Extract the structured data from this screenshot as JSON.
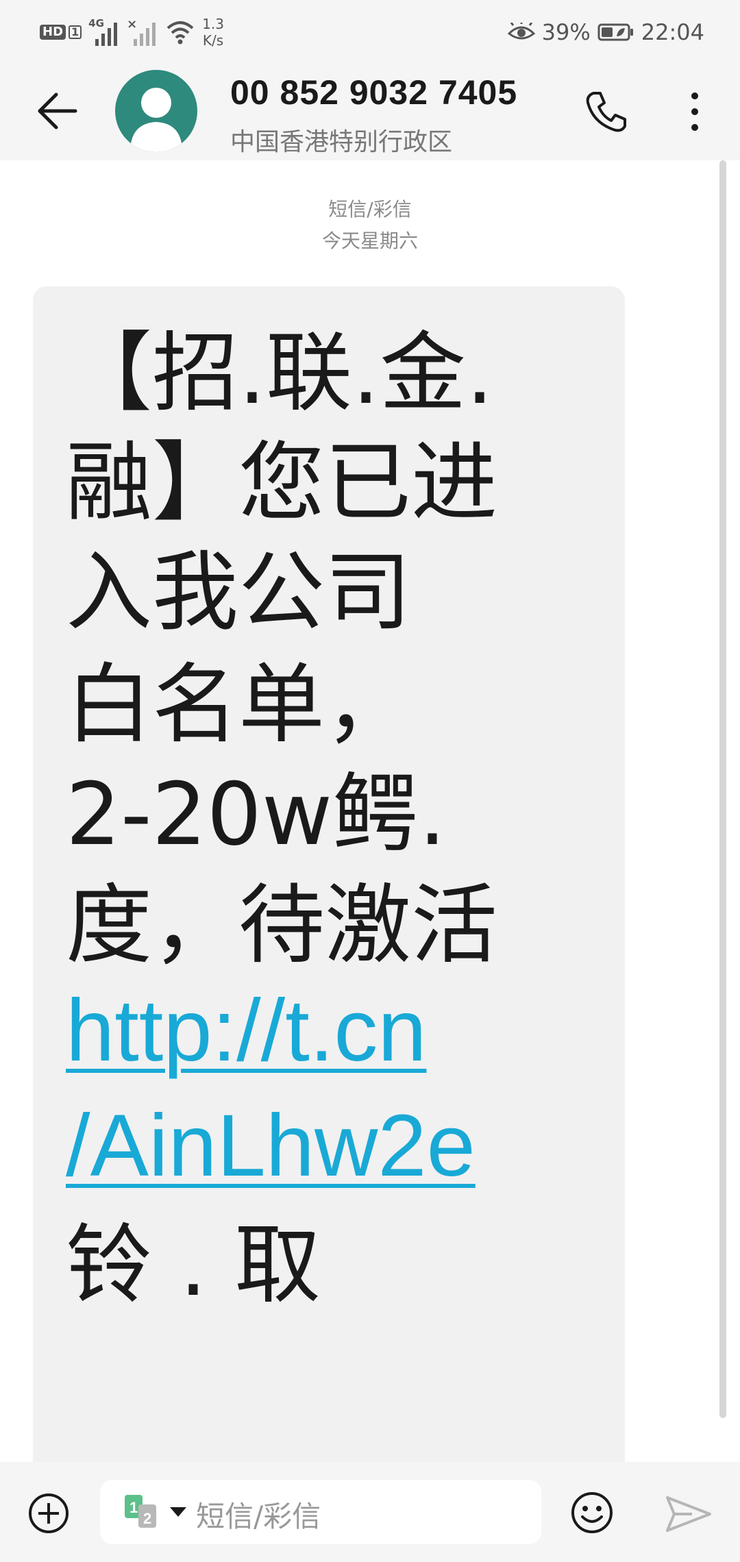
{
  "status_bar": {
    "hd_label": "HD",
    "hd_sim": "1",
    "network_type": "4G",
    "net_speed_value": "1.3",
    "net_speed_unit": "K/s",
    "battery_percent": "39%",
    "time": "22:04"
  },
  "header": {
    "phone_number": "00 852 9032 7405",
    "region": "中国香港特别行政区"
  },
  "conversation": {
    "message_type": "短信/彩信",
    "date_label": "今天星期六",
    "message_lines": [
      "【招.联.金.",
      "融】您已进",
      "入我公司",
      "白名单，",
      "2-20w鳄.",
      "度，待激活"
    ],
    "link_lines": [
      "http://t.cn",
      "/AinLhw2e"
    ],
    "tail_line": "铃 . 取"
  },
  "input_bar": {
    "placeholder": "短信/彩信",
    "sim_numbers": [
      "1",
      "2"
    ]
  },
  "colors": {
    "link": "#19a9d6",
    "avatar": "#2e8a7c",
    "bubble": "#f1f1f1"
  }
}
